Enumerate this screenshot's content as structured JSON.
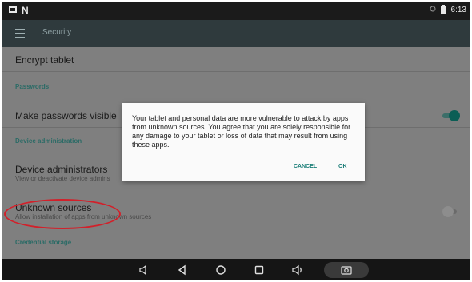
{
  "status_bar": {
    "left_icons": [
      "image-icon",
      "n-icon"
    ],
    "right_icons": [
      "notification-icon",
      "battery-icon"
    ],
    "time": "6:13"
  },
  "toolbar": {
    "title": "Security",
    "menu_icon": "hamburger-menu-icon"
  },
  "settings": {
    "encrypt_tablet": "Encrypt tablet",
    "passwords_header": "Passwords",
    "make_passwords_visible": "Make passwords visible",
    "device_admin_header": "Device administration",
    "device_administrators": "Device administrators",
    "device_administrators_sub": "View or deactivate device admins",
    "unknown_sources": "Unknown sources",
    "unknown_sources_sub": "Allow installation of apps from unknown sources",
    "credential_storage_header": "Credential storage"
  },
  "dialog": {
    "message": "Your tablet and personal data are more vulnerable to attack by apps from unknown sources. You agree that you are solely responsible for any damage to your tablet or loss of data that may result from using these apps.",
    "cancel_label": "CANCEL",
    "ok_label": "OK"
  },
  "toggles": {
    "make_passwords_visible": "on",
    "unknown_sources": "off"
  },
  "nav_bar": {
    "icons": [
      "volume-down-icon",
      "back-icon",
      "home-icon",
      "recents-icon",
      "volume-up-icon",
      "screenshot-icon"
    ]
  },
  "colors": {
    "accent": "#1d7f79",
    "highlight": "#d2202a"
  }
}
